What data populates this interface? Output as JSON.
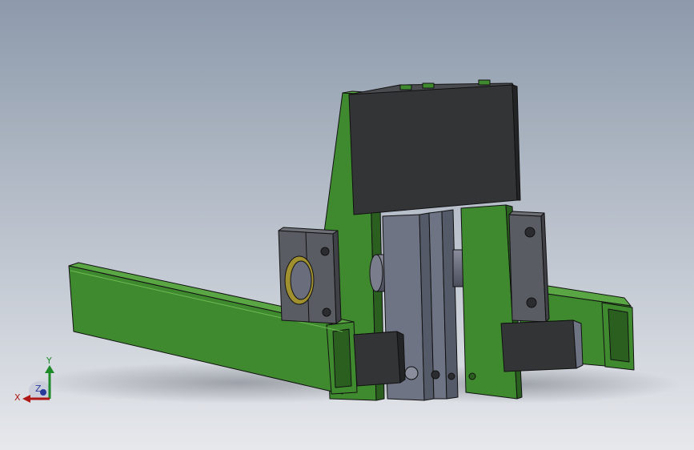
{
  "viewport": {
    "background": {
      "top": "#8d9aab",
      "bottom": "#e6e8ec"
    }
  },
  "model": {
    "colors": {
      "frame_green": "#3f8a2f",
      "frame_green_dark": "#2a5f20",
      "frame_green_light": "#5aa544",
      "dark_block": "#333436",
      "dark_block_side": "#232425",
      "gray_plate": "#6e7484",
      "gray_plate_dark": "#545a68",
      "bearing_gray": "#5a5c63",
      "shaft": "#6a6d7c",
      "bolt_ring": "#a09030"
    }
  },
  "triad": {
    "x_label": "X",
    "y_label": "Y",
    "z_label": "Z",
    "colors": {
      "x": "#b01818",
      "y": "#1e8a2a",
      "z": "#2a3a9a"
    }
  }
}
